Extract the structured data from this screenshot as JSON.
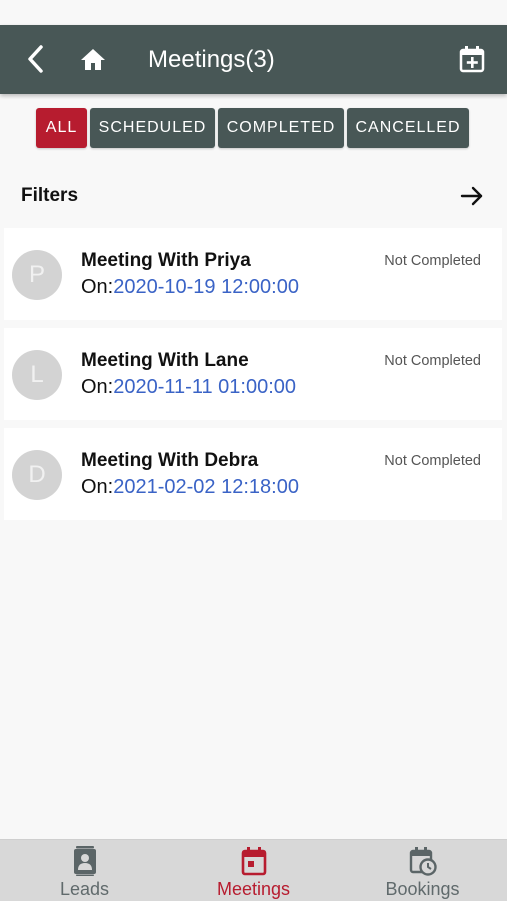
{
  "header": {
    "title": "Meetings(3)",
    "back_icon": "chevron-left-icon",
    "home_icon": "home-icon",
    "add_icon": "calendar-add-icon"
  },
  "tabs": [
    {
      "label": "ALL",
      "active": true
    },
    {
      "label": "SCHEDULED",
      "active": false
    },
    {
      "label": "COMPLETED",
      "active": false
    },
    {
      "label": "CANCELLED",
      "active": false
    }
  ],
  "filters": {
    "label": "Filters",
    "icon": "arrow-right-icon"
  },
  "meetings": [
    {
      "initial": "P",
      "title": "Meeting With Priya",
      "on_label": "On:",
      "date": "2020-10-19 12:00:00",
      "status": "Not Completed"
    },
    {
      "initial": "L",
      "title": "Meeting With Lane",
      "on_label": "On:",
      "date": "2020-11-11 01:00:00",
      "status": "Not Completed"
    },
    {
      "initial": "D",
      "title": "Meeting With Debra",
      "on_label": "On:",
      "date": "2021-02-02 12:18:00",
      "status": "Not Completed"
    }
  ],
  "bottom_nav": [
    {
      "label": "Leads",
      "icon": "contact-book-icon",
      "active": false
    },
    {
      "label": "Meetings",
      "icon": "calendar-icon",
      "active": true
    },
    {
      "label": "Bookings",
      "icon": "calendar-clock-icon",
      "active": false
    }
  ],
  "colors": {
    "header_bg": "#485756",
    "accent": "#b71c2f",
    "date_link": "#3a63c6",
    "avatar_bg": "#d3d3d3"
  }
}
